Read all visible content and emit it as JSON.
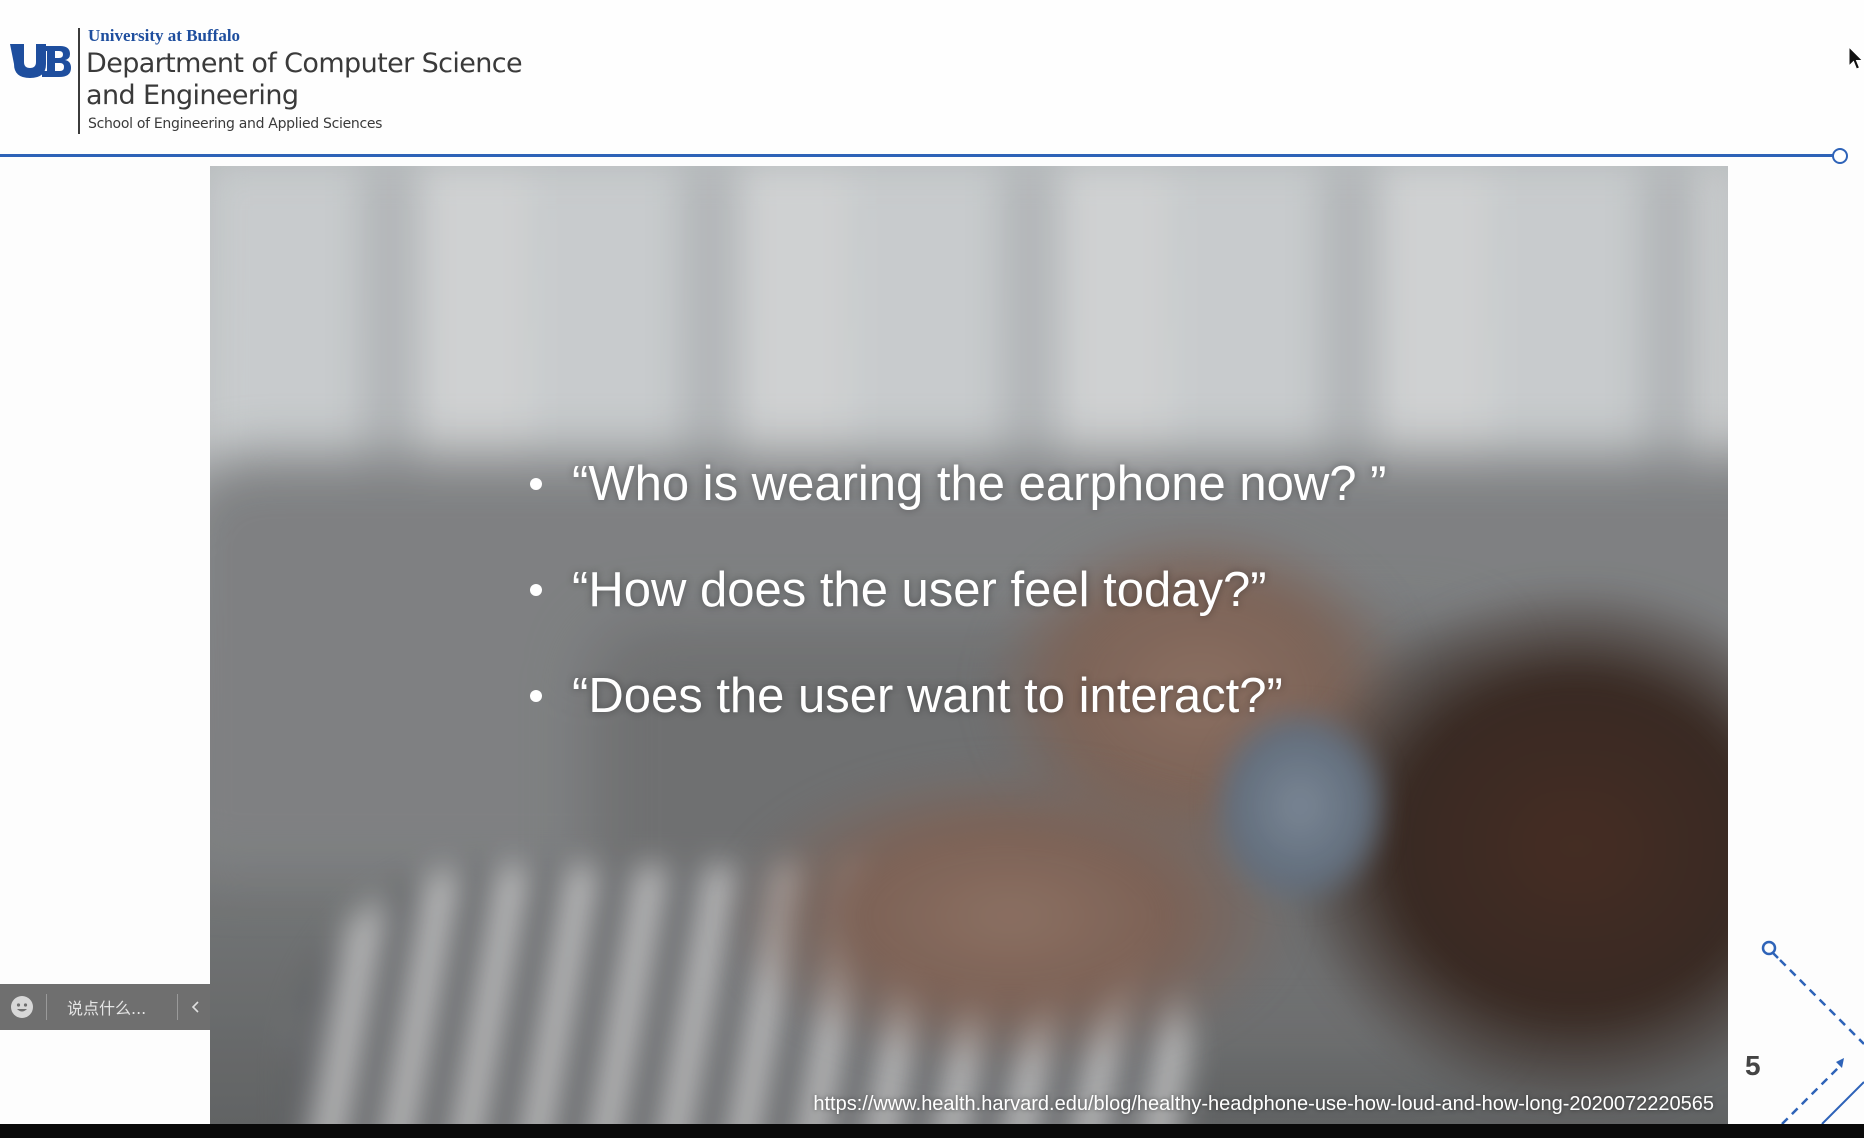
{
  "header": {
    "university": "University at Buffalo",
    "department": "Department of Computer Science and Engineering",
    "school": "School of Engineering and Applied Sciences",
    "accent_color": "#2e63b8"
  },
  "slide": {
    "bullets": [
      "“Who is wearing the earphone now? ”",
      "“How does the user feel today?”",
      "“Does the user want to interact?”"
    ],
    "source_url": "https://www.health.harvard.edu/blog/healthy-headphone-use-how-loud-and-how-long-2020072220565",
    "page_number": "5"
  },
  "chat": {
    "placeholder": "说点什么...",
    "emoji_icon": "emoji-icon",
    "collapse_icon": "chevron-left-icon"
  }
}
